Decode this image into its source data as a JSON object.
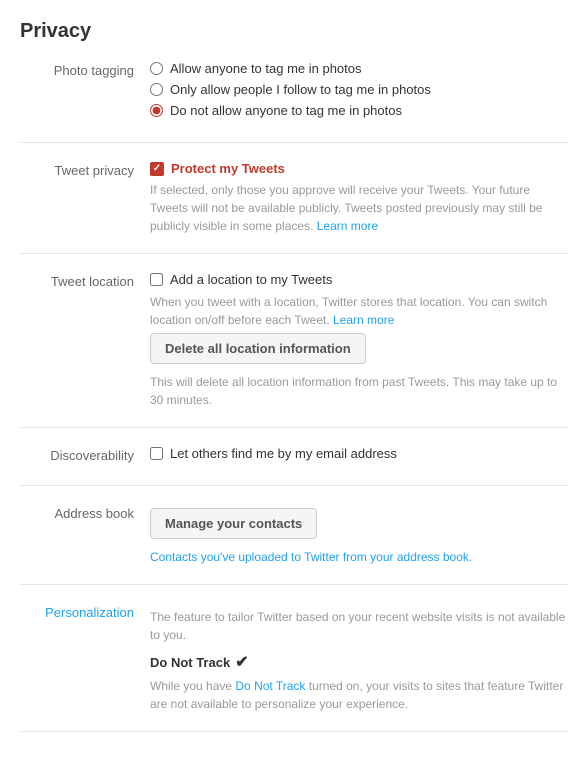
{
  "page": {
    "title": "Privacy"
  },
  "photo_tagging": {
    "label": "Photo tagging",
    "options": [
      {
        "id": "photo-anyone",
        "label": "Allow anyone to tag me in photos",
        "checked": false
      },
      {
        "id": "photo-follow",
        "label": "Only allow people I follow to tag me in photos",
        "checked": false
      },
      {
        "id": "photo-none",
        "label": "Do not allow anyone to tag me in photos",
        "checked": true
      }
    ]
  },
  "tweet_privacy": {
    "label": "Tweet privacy",
    "checkbox_label": "Protect my Tweets",
    "checked": true,
    "description": "If selected, only those you approve will receive your Tweets. Your future Tweets will not be available publicly. Tweets posted previously may still be publicly visible in some places.",
    "learn_more_label": "Learn more",
    "learn_more_url": "#"
  },
  "tweet_location": {
    "label": "Tweet location",
    "checkbox_label": "Add a location to my Tweets",
    "checked": false,
    "description": "When you tweet with a location, Twitter stores that location. You can switch location on/off before each Tweet.",
    "learn_more_label": "Learn more",
    "learn_more_url": "#",
    "delete_button_label": "Delete all location information",
    "delete_description": "This will delete all location information from past Tweets. This may take up to 30 minutes."
  },
  "discoverability": {
    "label": "Discoverability",
    "checkbox_label": "Let others find me by my email address",
    "checked": false
  },
  "address_book": {
    "label": "Address book",
    "button_label": "Manage your contacts",
    "description": "Contacts you've uploaded to Twitter from your address book."
  },
  "personalization": {
    "label": "Personalization",
    "description1": "The feature to tailor Twitter based on your recent website visits is not available to you.",
    "do_not_track_label": "Do Not Track",
    "checkmark": "✔",
    "description2": "While you have",
    "description2_link": "Do Not Track",
    "description2_rest": "turned on, your visits to sites that feature Twitter are not available to personalize your experience."
  }
}
